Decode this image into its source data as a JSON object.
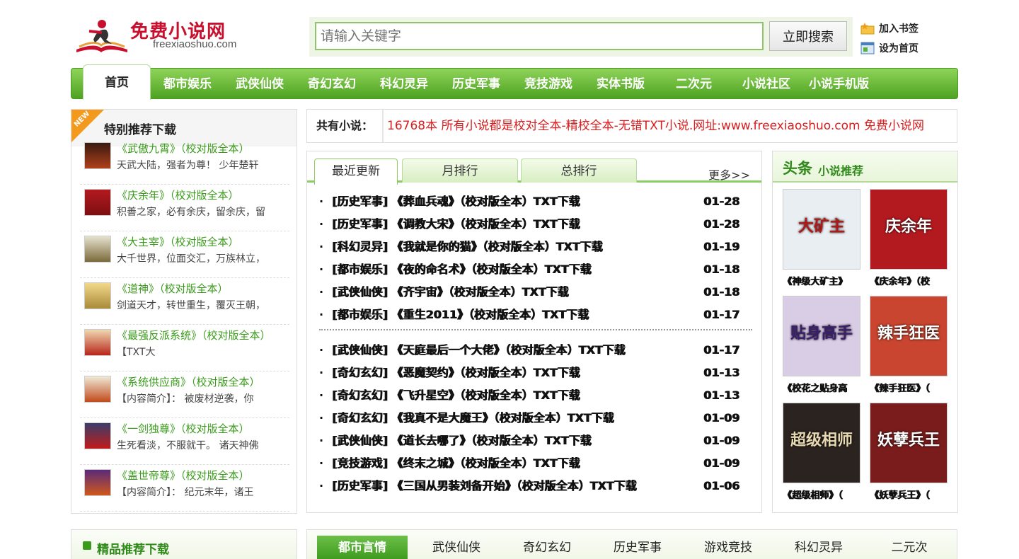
{
  "header": {
    "brand_name": "免费小说网",
    "brand_domain": "freexiaoshuo.com",
    "search_placeholder": "请输入关键字",
    "search_button": "立即搜索",
    "side_links": [
      "加入书签",
      "设为首页"
    ]
  },
  "nav": {
    "home": "首页",
    "items": [
      "都市娱乐",
      "武侠仙侠",
      "奇幻玄幻",
      "科幻灵异",
      "历史军事",
      "竞技游戏",
      "实体书版",
      "二次元",
      "小说社区",
      "小说手机版"
    ]
  },
  "left_panel": {
    "badge": "NEW",
    "title": "特别推荐下载",
    "items": [
      {
        "name": "《武傲九霄》（校对版全本）",
        "desc": "天武大陆，强者为尊！ 少年楚轩"
      },
      {
        "name": "《庆余年》（校对版全本）",
        "desc": "积善之家，必有余庆，留余庆，留"
      },
      {
        "name": "《大主宰》（校对版全本）",
        "desc": "大千世界，位面交汇，万族林立，"
      },
      {
        "name": "《道神》（校对版全本）",
        "desc": "剑道天才，转世重生，覆灭王朝，"
      },
      {
        "name": "《最强反派系统》（校对版全本）",
        "desc": "【TXT大"
      },
      {
        "name": "《系统供应商》（校对版全本）",
        "desc": "【内容简介】： 被废材逆袭，你"
      },
      {
        "name": "《一剑独尊》（校对版全本）",
        "desc": "生死看淡，不服就干。 诸天神佛"
      },
      {
        "name": "《盖世帝尊》（校对版全本）",
        "desc": "【内容简介】： 纪元末年，诸王"
      }
    ]
  },
  "ticker": {
    "label": "共有小说：",
    "text": "16768本 所有小说都是校对全本-精校全本-无错TXT小说.网址:www.freexiaoshuo.com 免费小说网"
  },
  "updates": {
    "tabs": [
      "最近更新",
      "月排行",
      "总排行"
    ],
    "more": "更多>>",
    "group1": [
      {
        "title": "[历史军事] 《葬血兵魂》（校对版全本）TXT下载",
        "date": "01-28"
      },
      {
        "title": "[历史军事] 《调教大宋》（校对版全本）TXT下载",
        "date": "01-28"
      },
      {
        "title": "[科幻灵异] 《我就是你的猫》（校对版全本）TXT下载",
        "date": "01-19"
      },
      {
        "title": "[都市娱乐] 《夜的命名术》（校对版全本）TXT下载",
        "date": "01-18"
      },
      {
        "title": "[武侠仙侠] 《齐宇宙》（校对版全本）TXT下载",
        "date": "01-18"
      },
      {
        "title": "[都市娱乐] 《重生2011》（校对版全本）TXT下载",
        "date": "01-17"
      }
    ],
    "group2": [
      {
        "title": "[武侠仙侠] 《天庭最后一个大佬》（校对版全本）TXT下载",
        "date": "01-17"
      },
      {
        "title": "[奇幻玄幻] 《恶魔契约》（校对版全本）TXT下载",
        "date": "01-13"
      },
      {
        "title": "[奇幻玄幻] 《飞升星空》（校对版全本）TXT下载",
        "date": "01-13"
      },
      {
        "title": "[奇幻玄幻] 《我真不是大魔王》（校对版全本）TXT下载",
        "date": "01-09"
      },
      {
        "title": "[武侠仙侠] 《道长去哪了》（校对版全本）TXT下载",
        "date": "01-09"
      },
      {
        "title": "[竞技游戏] 《终末之城》（校对版全本）TXT下载",
        "date": "01-09"
      },
      {
        "title": "[历史军事] 《三国从男装刘备开始》（校对版全本）TXT下载",
        "date": "01-06"
      }
    ]
  },
  "top_panel": {
    "title_big": "头条",
    "title_small": "小说推荐",
    "picks": [
      {
        "cover": "大矿主",
        "caption": "《神级大矿主》",
        "color": "#e9eef2",
        "text_color": "#b01818"
      },
      {
        "cover": "庆余年",
        "caption": "《庆余年》（校",
        "color": "#b31a1f",
        "text_color": "#ffffff"
      },
      {
        "cover": "贴身高手",
        "caption": "《校花之贴身高",
        "color": "#d9cde6",
        "text_color": "#3a1d6b"
      },
      {
        "cover": "辣手狂医",
        "caption": "《辣手狂医》（",
        "color": "#c9452f",
        "text_color": "#ffffff"
      },
      {
        "cover": "超级相师",
        "caption": "《超级相师》（",
        "color": "#2a2320",
        "text_color": "#e8d9b0"
      },
      {
        "cover": "妖孽兵王",
        "caption": "《妖孽兵王》（",
        "color": "#7a1c1c",
        "text_color": "#ffffff"
      }
    ]
  },
  "bottom": {
    "left_title": "精品推荐下载",
    "tabs": [
      "都市言情",
      "武侠仙侠",
      "奇幻玄幻",
      "历史军事",
      "游戏竞技",
      "科幻灵异",
      "二元次"
    ]
  }
}
